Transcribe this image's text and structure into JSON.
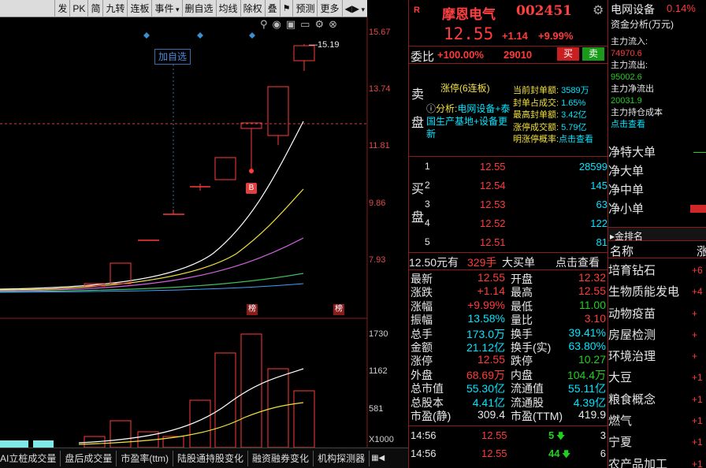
{
  "toolbar": {
    "items": [
      "发",
      "PK",
      "简",
      "九转",
      "连板",
      "事件",
      "删自选",
      "均线",
      "除权",
      "叠",
      "FLAG",
      "预测",
      "更多",
      "◀▶"
    ]
  },
  "chart": {
    "price_ticks": [
      "15.67",
      "13.74",
      "11.81",
      "9.86",
      "7.93"
    ],
    "volume_ticks": [
      "1730",
      "1162",
      "581"
    ],
    "volume_unit": "X1000",
    "high_annotation": "15.19",
    "add_watch_label": "加自选",
    "buy_marker": "B",
    "bang_marker_1": "榜",
    "bang_marker_2": "榜"
  },
  "tabs": {
    "items": [
      "AI立桩成交量",
      "盘后成交量",
      "市盈率(ttm)",
      "陆股通持股变化",
      "融资融券变化",
      "机构探测器"
    ]
  },
  "stock": {
    "flag": "R",
    "name": "摩恩电气",
    "code": "002451",
    "price": "12.55",
    "change": "+1.14",
    "change_pct": "+9.99%",
    "weibi_label": "委比",
    "weibi": "+100.00%",
    "weicha": "29010",
    "buy_btn": "买",
    "sell_btn": "卖"
  },
  "sell_side": {
    "label": "卖\n\n盘",
    "limit_up": "涨停(6连板)",
    "analysis_prefix": "分析:",
    "analysis_text": "电网设备+泰国生产基地+设备更新",
    "metrics": [
      {
        "k": "当前封单额:",
        "v": "3589万"
      },
      {
        "k": "封单占成交:",
        "v": "1.65%"
      },
      {
        "k": "最高封单额:",
        "v": "3.42亿"
      },
      {
        "k": "涨停成交额:",
        "v": "5.79亿"
      },
      {
        "k": "明涨停概率:",
        "v": "点击查看"
      }
    ]
  },
  "buy_side": {
    "label": "买\n\n盘",
    "levels": [
      {
        "n": "1",
        "p": "12.55",
        "q": "28599"
      },
      {
        "n": "2",
        "p": "12.54",
        "q": "145"
      },
      {
        "n": "3",
        "p": "12.53",
        "q": "63"
      },
      {
        "n": "4",
        "p": "12.52",
        "q": "122"
      },
      {
        "n": "5",
        "p": "12.51",
        "q": "81"
      }
    ]
  },
  "big_order": {
    "price": "12.50元有",
    "qty": "329手",
    "label": "大买单",
    "link": "点击查看"
  },
  "quote": [
    {
      "k1": "最新",
      "v1": "12.55",
      "k2": "开盘",
      "v2": "12.32"
    },
    {
      "k1": "涨跌",
      "v1": "+1.14",
      "k2": "最高",
      "v2": "12.55"
    },
    {
      "k1": "涨幅",
      "v1": "+9.99%",
      "k2": "最低",
      "v2": "11.00"
    },
    {
      "k1": "振幅",
      "v1": "13.58%",
      "k2": "量比",
      "v2": "3.10"
    },
    {
      "k1": "总手",
      "v1": "173.0万",
      "k2": "换手",
      "v2": "39.41%"
    },
    {
      "k1": "金额",
      "v1": "21.12亿",
      "k2": "换手(实)",
      "v2": "63.80%"
    },
    {
      "k1": "涨停",
      "v1": "12.55",
      "k2": "跌停",
      "v2": "10.27"
    },
    {
      "k1": "外盘",
      "v1": "68.69万",
      "k2": "内盘",
      "v2": "104.4万"
    },
    {
      "k1": "总市值",
      "v1": "55.30亿",
      "k2": "流通值",
      "v2": "55.11亿"
    },
    {
      "k1": "总股本",
      "v1": "4.41亿",
      "k2": "流通股",
      "v2": "4.39亿"
    },
    {
      "k1": "市盈(静)",
      "v1": "309.4",
      "k2": "市盈(TTM)",
      "v2": "419.9"
    }
  ],
  "ticks": [
    {
      "t": "14:56",
      "p": "12.55",
      "q": "5",
      "n": "3"
    },
    {
      "t": "14:56",
      "p": "12.55",
      "q": "44",
      "n": "6"
    }
  ],
  "right": {
    "sector": "电网设备",
    "sector_pct": "0.14%",
    "fund_title": "资金分析(万元)",
    "inflow_label": "主力流入:",
    "inflow": "74970.6",
    "outflow_label": "主力流出:",
    "outflow": "95002.6",
    "net_label": "主力净流出",
    "net": "20031.9",
    "hold_label": "主力持仓成本",
    "hold_link": "点击查看",
    "flows": [
      "净特大单",
      "净大单",
      "净中单",
      "净小单"
    ],
    "rank_title": "金排名",
    "rank_header": "名称",
    "rank_header2": "涨",
    "ranks": [
      {
        "name": "培育钻石",
        "v": "+6"
      },
      {
        "name": "生物质能发电",
        "v": "+4"
      },
      {
        "name": "动物疫苗",
        "v": "+"
      },
      {
        "name": "房屋检测",
        "v": "+"
      },
      {
        "name": "环境治理",
        "v": "+"
      },
      {
        "name": "大豆",
        "v": "+1"
      },
      {
        "name": "粮食概念",
        "v": "+1"
      },
      {
        "name": "燃气",
        "v": "+1"
      },
      {
        "name": "宁夏",
        "v": "+1"
      },
      {
        "name": "农产品加工",
        "v": "+1"
      }
    ]
  }
}
